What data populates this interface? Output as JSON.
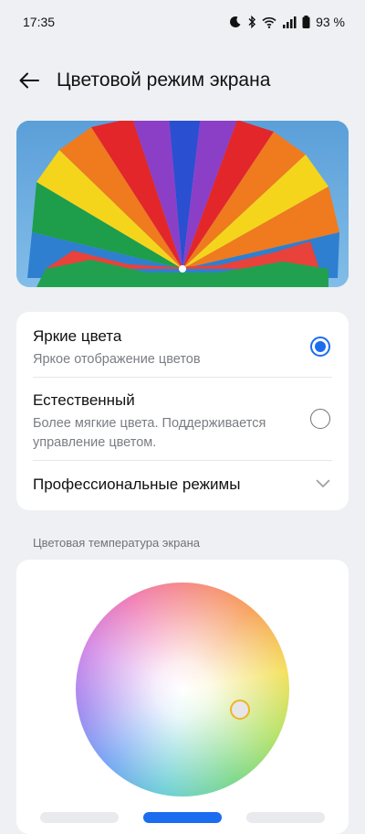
{
  "status": {
    "time": "17:35",
    "battery": "93 %"
  },
  "header": {
    "title": "Цветовой режим экрана"
  },
  "modes": {
    "vivid": {
      "title": "Яркие цвета",
      "subtitle": "Яркое отображение цветов",
      "selected": true
    },
    "natural": {
      "title": "Естественный",
      "subtitle_line1": "Более мягкие цвета. Поддерживается",
      "subtitle_line2": "управление цветом.",
      "selected": false
    },
    "pro": {
      "title": "Профессиональные режимы"
    }
  },
  "temperature": {
    "label": "Цветовая температура экрана"
  },
  "colors": {
    "accent": "#1c6cf0",
    "background": "#eef0f3",
    "card": "#ffffff"
  }
}
